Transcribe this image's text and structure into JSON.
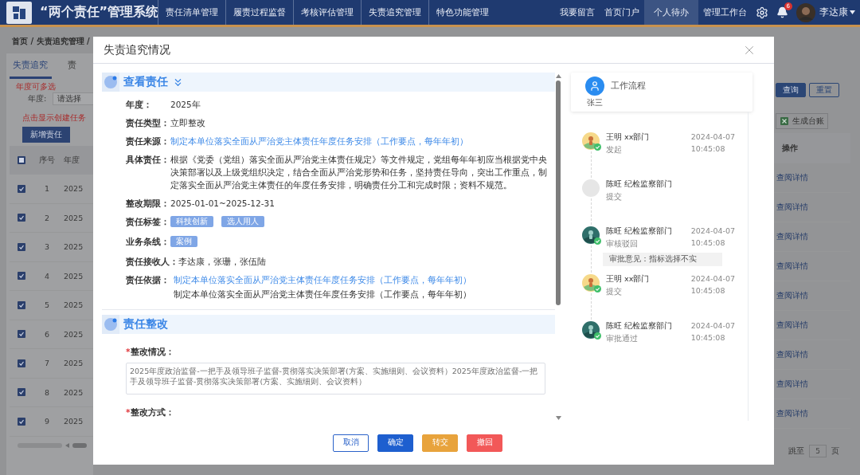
{
  "header": {
    "title": "“两个责任”管理系统",
    "nav": [
      "责任清单管理",
      "履责过程监督",
      "考核评估管理",
      "失责追究管理",
      "特色功能管理"
    ],
    "links": [
      {
        "label": "我要留言",
        "selected": false
      },
      {
        "label": "首页门户",
        "selected": false
      },
      {
        "label": "个人待办",
        "selected": true
      },
      {
        "label": "管理工作台",
        "selected": false
      }
    ],
    "notifications": "6",
    "user": "李达康"
  },
  "page": {
    "breadcrumb": "首页 / 失责追究管理 /",
    "tabs": [
      {
        "label": "失责追究",
        "selected": true
      },
      {
        "label": "责",
        "selected": false
      }
    ],
    "year_hint": "年度可多选",
    "year_label": "年度:",
    "year_placeholder": "请选择",
    "create_hint": "点击显示创建任务",
    "add_button": "新增责任",
    "select_all_indeterminate": true,
    "columns": [
      "序号",
      "年度"
    ],
    "rows": [
      {
        "index": "1",
        "year": "2025",
        "checked": true,
        "action": "查阅详情"
      },
      {
        "index": "2",
        "year": "2025",
        "checked": true,
        "action": "查阅详情"
      },
      {
        "index": "3",
        "year": "2025",
        "checked": true,
        "action": "查阅详情"
      },
      {
        "index": "4",
        "year": "2025",
        "checked": true,
        "action": "查阅详情"
      },
      {
        "index": "5",
        "year": "2025",
        "checked": true,
        "action": "查阅详情"
      },
      {
        "index": "6",
        "year": "2025",
        "checked": true,
        "action": "查阅详情"
      },
      {
        "index": "7",
        "year": "2025",
        "checked": true,
        "action": "查阅详情"
      },
      {
        "index": "8",
        "year": "2025",
        "checked": true,
        "action": "查阅详情"
      },
      {
        "index": "9",
        "year": "2025",
        "checked": true,
        "action": "查阅详情"
      }
    ],
    "search_button": "查询",
    "reset_button": "重置",
    "ledger_button": "生成台账",
    "action_column": "操作",
    "pagination": {
      "jump_label": "跳至",
      "page": "5",
      "page_suffix": "页"
    }
  },
  "dialog": {
    "title": "失责追究情况",
    "responsibility": {
      "title": "查看责任",
      "fields": [
        {
          "kind": "text",
          "label": "年度：",
          "value": "2025年"
        },
        {
          "kind": "text",
          "label": "责任类型：",
          "value": "立即整改"
        },
        {
          "kind": "link",
          "label": "责任来源：",
          "value": "制定本单位落实全面从严治党主体责任年度任务安排（工作要点，每年年初）"
        },
        {
          "kind": "text",
          "label": "具体责任：",
          "value": "根据《党委（党组）落实全面从严治党主体责任规定》等文件规定，党组每年年初应当根据党中央决策部署以及上级党组织决定，结合全面从严治党形势和任务，坚持责任导向，突出工作重点，制定落实全面从严治党主体责任的年度任务安排，明确责任分工和完成时限；资料不规范。"
        },
        {
          "kind": "text",
          "label": "整改期限：",
          "value": "2025-01-01~2025-12-31"
        },
        {
          "kind": "tags",
          "label": "责任标签：",
          "tags": [
            "科技创新",
            "选人用人"
          ]
        },
        {
          "kind": "tags",
          "label": "业务条线：",
          "tags": [
            "案例"
          ]
        },
        {
          "kind": "text",
          "label": "责任接收人：",
          "value": "李达康，张珊，张伍陆"
        },
        {
          "kind": "basis",
          "label": "责任依据：",
          "link": "制定本单位落实全面从严治党主体责任年度任务安排（工作要点，每年年初）",
          "value": "制定本单位落实全面从严治党主体责任年度任务安排（工作要点，每年年初）"
        }
      ]
    },
    "rectification": {
      "title": "责任整改",
      "fields": [
        {
          "mark": "*",
          "label": "整改情况：",
          "value": "2025年度政治监督-一把手及领导班子监督-贯彻落实决策部署(方案、实施细则、会议资料）2025年度政治监督-一把手及领导班子监督-贯彻落实决策部署(方案、实施细则、会议资料）"
        },
        {
          "mark": "*",
          "label": "整改方式："
        }
      ]
    },
    "workflow": {
      "title": "工作流程",
      "user": "张三",
      "steps": [
        {
          "kind": "warm",
          "done": true,
          "name": "王明 xx部门",
          "action": "发起",
          "date": "2024-04-07",
          "time": "10:45:08"
        },
        {
          "kind": "empty",
          "done": false,
          "name": "陈旺 纪检监察部门",
          "action": "提交"
        },
        {
          "kind": "cool",
          "done": true,
          "name": "陈旺 纪检监察部门",
          "action": "审核驳回",
          "date": "2024-04-07",
          "time": "10:45:08",
          "comment": "审批意见：指标选择不实"
        },
        {
          "kind": "warm",
          "done": true,
          "name": "王明 xx部门",
          "action": "提交",
          "date": "2024-04-07",
          "time": "10:45:08"
        },
        {
          "kind": "cool",
          "done": true,
          "name": "陈旺 纪检监察部门",
          "action": "审批通过",
          "date": "2024-04-07",
          "time": "10:45:08"
        }
      ]
    },
    "buttons": [
      {
        "label": "取消",
        "kind": "outline"
      },
      {
        "label": "确定",
        "kind": "primary"
      },
      {
        "label": "转交",
        "kind": "warning"
      },
      {
        "label": "撤回",
        "kind": "danger"
      }
    ]
  }
}
